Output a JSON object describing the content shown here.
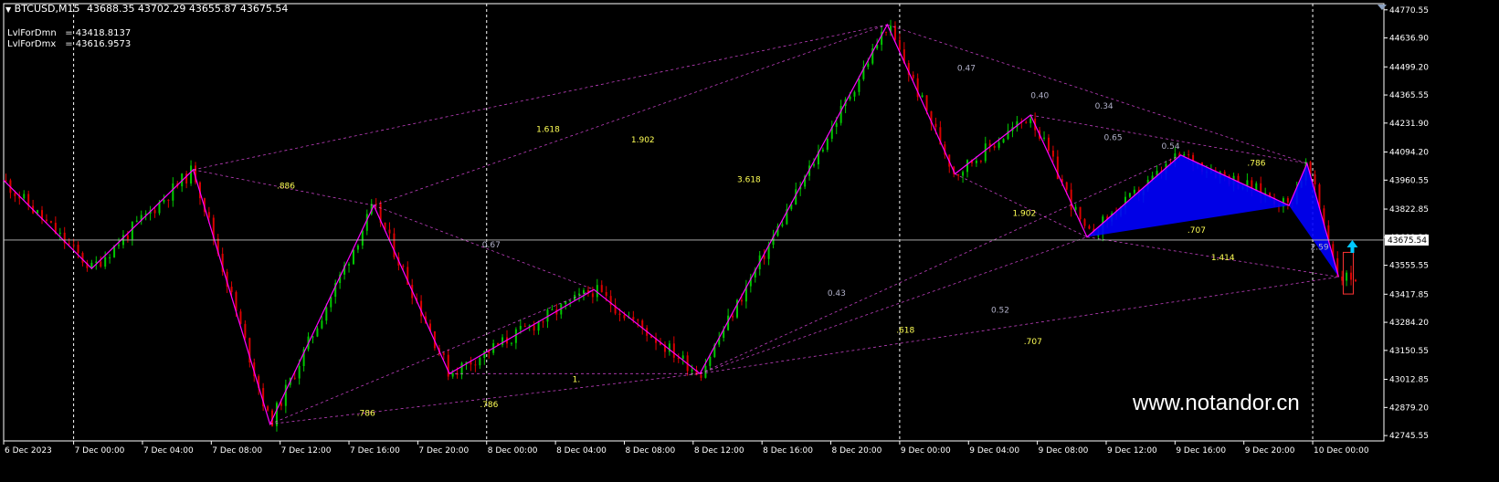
{
  "header": {
    "symbol": "BTCUSD,M15",
    "ohlc": "43688.35 43702.29 43655.87 43675.54",
    "ind1_name": "LvlForDmn",
    "ind1_value": "=   43418.8137",
    "ind2_name": "LvlForDmx",
    "ind2_value": "=   43616.9573"
  },
  "watermark": "www.notandor.cn",
  "colors": {
    "background": "#000000",
    "axis": "#ffffff",
    "bull_candle": "#00c800",
    "bear_candle": "#dc0000",
    "zigzag": "#ff00ff",
    "fib_line": "#ff55ff",
    "fib_text": "#ffff55",
    "ratio_text": "#b0b0c8",
    "pattern_fill": "#0000ff",
    "arrow": "#00c8ff"
  },
  "chart_data": {
    "type": "candlestick",
    "instrument": "BTCUSD",
    "timeframe": "M15",
    "ylim": [
      42720,
      44800
    ],
    "xlim": [
      0,
      1215
    ],
    "current_price": 43675.54,
    "y_ticks": [
      "44770.55",
      "44636.90",
      "44499.20",
      "44365.55",
      "44231.90",
      "44094.20",
      "43960.55",
      "43822.85",
      "43689.20",
      "43555.55",
      "43417.85",
      "43284.20",
      "43150.55",
      "43012.85",
      "42879.20",
      "42745.55"
    ],
    "x_ticks": [
      {
        "x": 0,
        "label": "6 Dec 2023"
      },
      {
        "x": 62,
        "label": "7 Dec 00:00"
      },
      {
        "x": 123,
        "label": "7 Dec 04:00"
      },
      {
        "x": 184,
        "label": "7 Dec 08:00"
      },
      {
        "x": 245,
        "label": "7 Dec 12:00"
      },
      {
        "x": 306,
        "label": "7 Dec 16:00"
      },
      {
        "x": 367,
        "label": "7 Dec 20:00"
      },
      {
        "x": 428,
        "label": "8 Dec 00:00"
      },
      {
        "x": 489,
        "label": "8 Dec 04:00"
      },
      {
        "x": 550,
        "label": "8 Dec 08:00"
      },
      {
        "x": 611,
        "label": "8 Dec 12:00"
      },
      {
        "x": 672,
        "label": "8 Dec 16:00"
      },
      {
        "x": 733,
        "label": "8 Dec 20:00"
      },
      {
        "x": 794,
        "label": "9 Dec 00:00"
      },
      {
        "x": 855,
        "label": "9 Dec 04:00"
      },
      {
        "x": 916,
        "label": "9 Dec 08:00"
      },
      {
        "x": 977,
        "label": "9 Dec 12:00"
      },
      {
        "x": 1038,
        "label": "9 Dec 16:00"
      },
      {
        "x": 1099,
        "label": "9 Dec 20:00"
      },
      {
        "x": 1160,
        "label": "10 Dec 00:00"
      }
    ],
    "day_separators": [
      62,
      428,
      794,
      1160
    ],
    "zigzag": [
      [
        0,
        43960
      ],
      [
        78,
        43540
      ],
      [
        168,
        44010
      ],
      [
        236,
        42800
      ],
      [
        328,
        43840
      ],
      [
        395,
        43040
      ],
      [
        523,
        43440
      ],
      [
        617,
        43040
      ],
      [
        783,
        44700
      ],
      [
        843,
        43990
      ],
      [
        910,
        44270
      ],
      [
        960,
        43690
      ],
      [
        1043,
        44080
      ],
      [
        1139,
        43840
      ],
      [
        1155,
        44040
      ],
      [
        1183,
        43500
      ]
    ],
    "pattern": [
      [
        [
          960,
          43690
        ],
        [
          1043,
          44080
        ],
        [
          1139,
          43840
        ]
      ],
      [
        [
          1139,
          43840
        ],
        [
          1155,
          44040
        ],
        [
          1183,
          43500
        ]
      ]
    ],
    "pattern_low_box": [
      1183,
      43418.8137,
      43616.9573
    ],
    "fib_lines": [
      [
        [
          168,
          44010
        ],
        [
          328,
          43840
        ]
      ],
      [
        [
          168,
          44010
        ],
        [
          783,
          44700
        ]
      ],
      [
        [
          328,
          43840
        ],
        [
          783,
          44700
        ]
      ],
      [
        [
          236,
          42800
        ],
        [
          523,
          43440
        ]
      ],
      [
        [
          236,
          42800
        ],
        [
          617,
          43040
        ]
      ],
      [
        [
          395,
          43040
        ],
        [
          617,
          43040
        ]
      ],
      [
        [
          617,
          43040
        ],
        [
          960,
          43690
        ]
      ],
      [
        [
          617,
          43040
        ],
        [
          1043,
          44080
        ]
      ],
      [
        [
          617,
          43040
        ],
        [
          1183,
          43500
        ]
      ],
      [
        [
          843,
          43990
        ],
        [
          960,
          43690
        ]
      ],
      [
        [
          960,
          43690
        ],
        [
          1183,
          43500
        ]
      ],
      [
        [
          783,
          44700
        ],
        [
          1155,
          44040
        ]
      ],
      [
        [
          910,
          44270
        ],
        [
          1155,
          44040
        ]
      ],
      [
        [
          328,
          43840
        ],
        [
          523,
          43440
        ]
      ]
    ],
    "fib_labels": [
      {
        "x": 242,
        "y": 43920,
        "text": ".886",
        "style": "fib"
      },
      {
        "x": 472,
        "y": 44190,
        "text": "1.618",
        "style": "fib"
      },
      {
        "x": 556,
        "y": 44140,
        "text": "1.902",
        "style": "fib"
      },
      {
        "x": 650,
        "y": 43950,
        "text": "3.618",
        "style": "fib"
      },
      {
        "x": 313,
        "y": 42840,
        "text": ".786",
        "style": "fib"
      },
      {
        "x": 422,
        "y": 42880,
        "text": ".786",
        "style": "fib"
      },
      {
        "x": 504,
        "y": 43000,
        "text": "1.",
        "style": "fib"
      },
      {
        "x": 791,
        "y": 43235,
        "text": ".618",
        "style": "fib"
      },
      {
        "x": 904,
        "y": 43180,
        "text": ".707",
        "style": "fib"
      },
      {
        "x": 894,
        "y": 43790,
        "text": "1.902",
        "style": "fib"
      },
      {
        "x": 1049,
        "y": 43710,
        "text": ".707",
        "style": "fib"
      },
      {
        "x": 1070,
        "y": 43580,
        "text": "1.414",
        "style": "fib"
      },
      {
        "x": 1102,
        "y": 44030,
        "text": ".786",
        "style": "fib"
      },
      {
        "x": 424,
        "y": 43640,
        "text": "0.67",
        "style": "ratio"
      },
      {
        "x": 730,
        "y": 43410,
        "text": "0.43",
        "style": "ratio"
      },
      {
        "x": 875,
        "y": 43330,
        "text": "0.52",
        "style": "ratio"
      },
      {
        "x": 845,
        "y": 44480,
        "text": "0.47",
        "style": "ratio"
      },
      {
        "x": 910,
        "y": 44350,
        "text": "0.40",
        "style": "ratio"
      },
      {
        "x": 967,
        "y": 44300,
        "text": "0.34",
        "style": "ratio"
      },
      {
        "x": 975,
        "y": 44150,
        "text": "0.65",
        "style": "ratio"
      },
      {
        "x": 1026,
        "y": 44110,
        "text": "0.54",
        "style": "ratio"
      },
      {
        "x": 1158,
        "y": 43630,
        "text": "2.59",
        "style": "ratio"
      }
    ]
  }
}
